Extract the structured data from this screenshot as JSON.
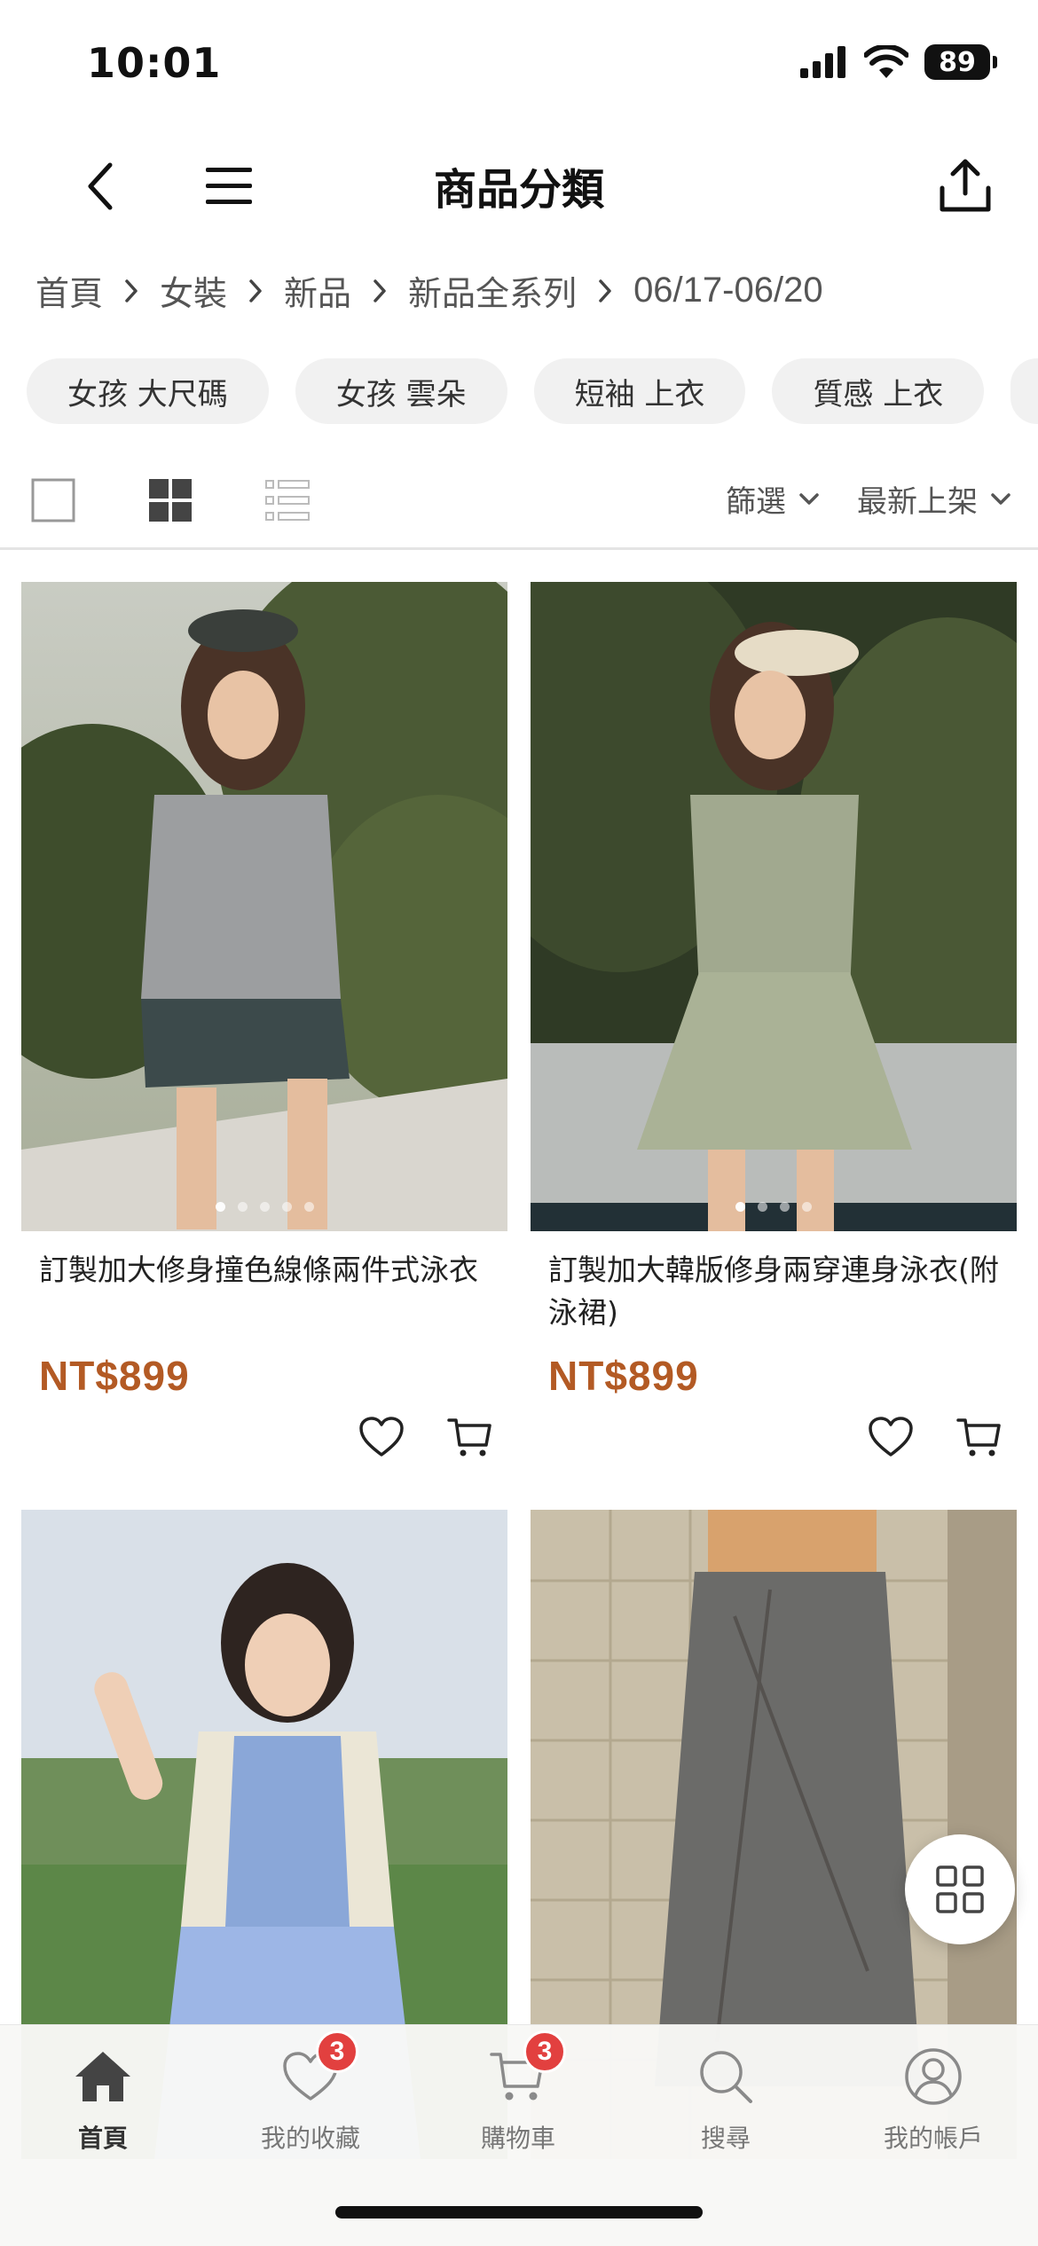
{
  "status": {
    "time": "10:01",
    "battery": "89"
  },
  "header": {
    "title": "商品分類"
  },
  "breadcrumb": {
    "items": [
      "首頁",
      "女裝",
      "新品",
      "新品全系列"
    ],
    "current": "06/17-06/20"
  },
  "tags": [
    "女孩 大尺碼",
    "女孩 雲朵",
    "短袖 上衣",
    "質感 上衣"
  ],
  "toolbar": {
    "filter_label": "篩選",
    "sort_label": "最新上架"
  },
  "products": [
    {
      "name": "訂製加大修身撞色線條兩件式泳衣",
      "price": "NT$899"
    },
    {
      "name": "訂製加大韓版修身兩穿連身泳衣(附泳裙)",
      "price": "NT$899"
    }
  ],
  "bottom_nav": {
    "items": [
      {
        "label": "首頁",
        "icon": "home-icon",
        "active": true
      },
      {
        "label": "我的收藏",
        "icon": "heart-icon",
        "badge": "3"
      },
      {
        "label": "購物車",
        "icon": "cart-icon",
        "badge": "3"
      },
      {
        "label": "搜尋",
        "icon": "search-icon"
      },
      {
        "label": "我的帳戶",
        "icon": "user-icon"
      }
    ]
  },
  "colors": {
    "price": "#b35a24",
    "badge": "#e2403f",
    "tag_bg": "#f1f1f1"
  }
}
